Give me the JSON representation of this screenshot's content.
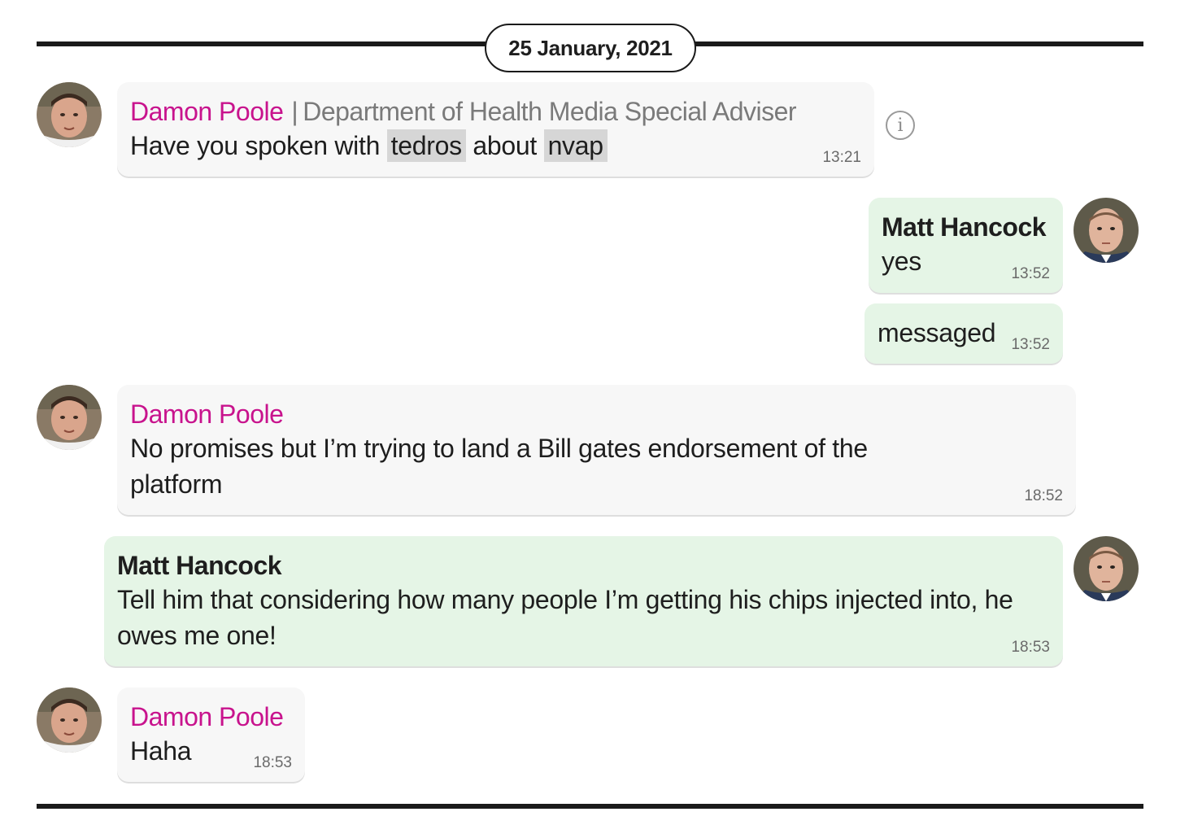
{
  "date_divider": "25 January, 2021",
  "messages": [
    {
      "sender": "Damon Poole",
      "role_separator": "|",
      "role": "Department of Health Media Special Adviser",
      "text_parts": [
        "Have you spoken with ",
        "tedros",
        " about ",
        "nvap"
      ],
      "time": "13:21"
    },
    {
      "sender": "Matt Hancock",
      "text": "yes",
      "time": "13:52"
    },
    {
      "text": "messaged",
      "time": "13:52"
    },
    {
      "sender": "Damon Poole",
      "text": "No promises but I’m trying to land a Bill gates endorsement of the platform",
      "time": "18:52"
    },
    {
      "sender": "Matt Hancock",
      "text": "Tell him that considering how many people I’m getting his chips injected into, he owes me one!",
      "time": "18:53"
    },
    {
      "sender": "Damon Poole",
      "text": "Haha",
      "time": "18:53"
    }
  ],
  "icons": {
    "info": "info-icon",
    "avatar_damon": "damon-poole-avatar",
    "avatar_matt": "matt-hancock-avatar"
  },
  "colors": {
    "damon_name": "#c8138d",
    "incoming_bubble": "#f7f7f7",
    "outgoing_bubble": "#e5f5e6",
    "divider": "#1a1a1a"
  }
}
